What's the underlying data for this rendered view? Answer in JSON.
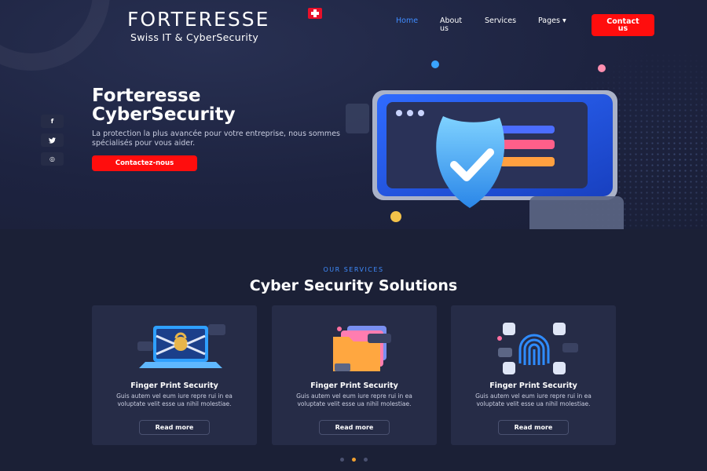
{
  "brand": {
    "name": "FORTERESSE",
    "tagline": "Swiss IT & CyberSecurity",
    "colors": {
      "accent_red": "#ff0d0d",
      "accent_blue": "#3f8cff",
      "background": "#1b2036",
      "card": "#262c47"
    }
  },
  "nav": {
    "items": [
      {
        "label": "Home",
        "active": true
      },
      {
        "label": "About us",
        "active": false
      },
      {
        "label": "Services",
        "active": false
      },
      {
        "label": "Pages ▾",
        "active": false
      }
    ],
    "contact_label": "Contact us"
  },
  "social": [
    {
      "icon": "facebook-icon",
      "glyph": "f"
    },
    {
      "icon": "twitter-icon",
      "glyph": "🐦"
    },
    {
      "icon": "instagram-icon",
      "glyph": "◎"
    }
  ],
  "hero": {
    "title_line1": "Forteresse",
    "title_line2": "CyberSecurity",
    "description": "La protection la plus avancée pour votre entreprise, nous sommes spécialisés pour vous aider.",
    "cta_label": "Contactez-nous",
    "illustration": "shield-check-icon"
  },
  "services": {
    "eyebrow": "OUR SERVICES",
    "title": "Cyber Security Solutions",
    "cards": [
      {
        "icon": "laptop-lock-icon",
        "title": "Finger Print Security",
        "description": "Guis autem vel eum iure repre rui in ea voluptate velit esse ua nihil molestiae.",
        "button": "Read more"
      },
      {
        "icon": "folders-icon",
        "title": "Finger Print Security",
        "description": "Guis autem vel eum iure repre rui in ea voluptate velit esse ua nihil molestiae.",
        "button": "Read more"
      },
      {
        "icon": "fingerprint-icon",
        "title": "Finger Print Security",
        "description": "Guis autem vel eum iure repre rui in ea voluptate velit esse ua nihil molestiae.",
        "button": "Read more"
      }
    ]
  },
  "pagination": {
    "count": 3,
    "active_index": 1
  }
}
